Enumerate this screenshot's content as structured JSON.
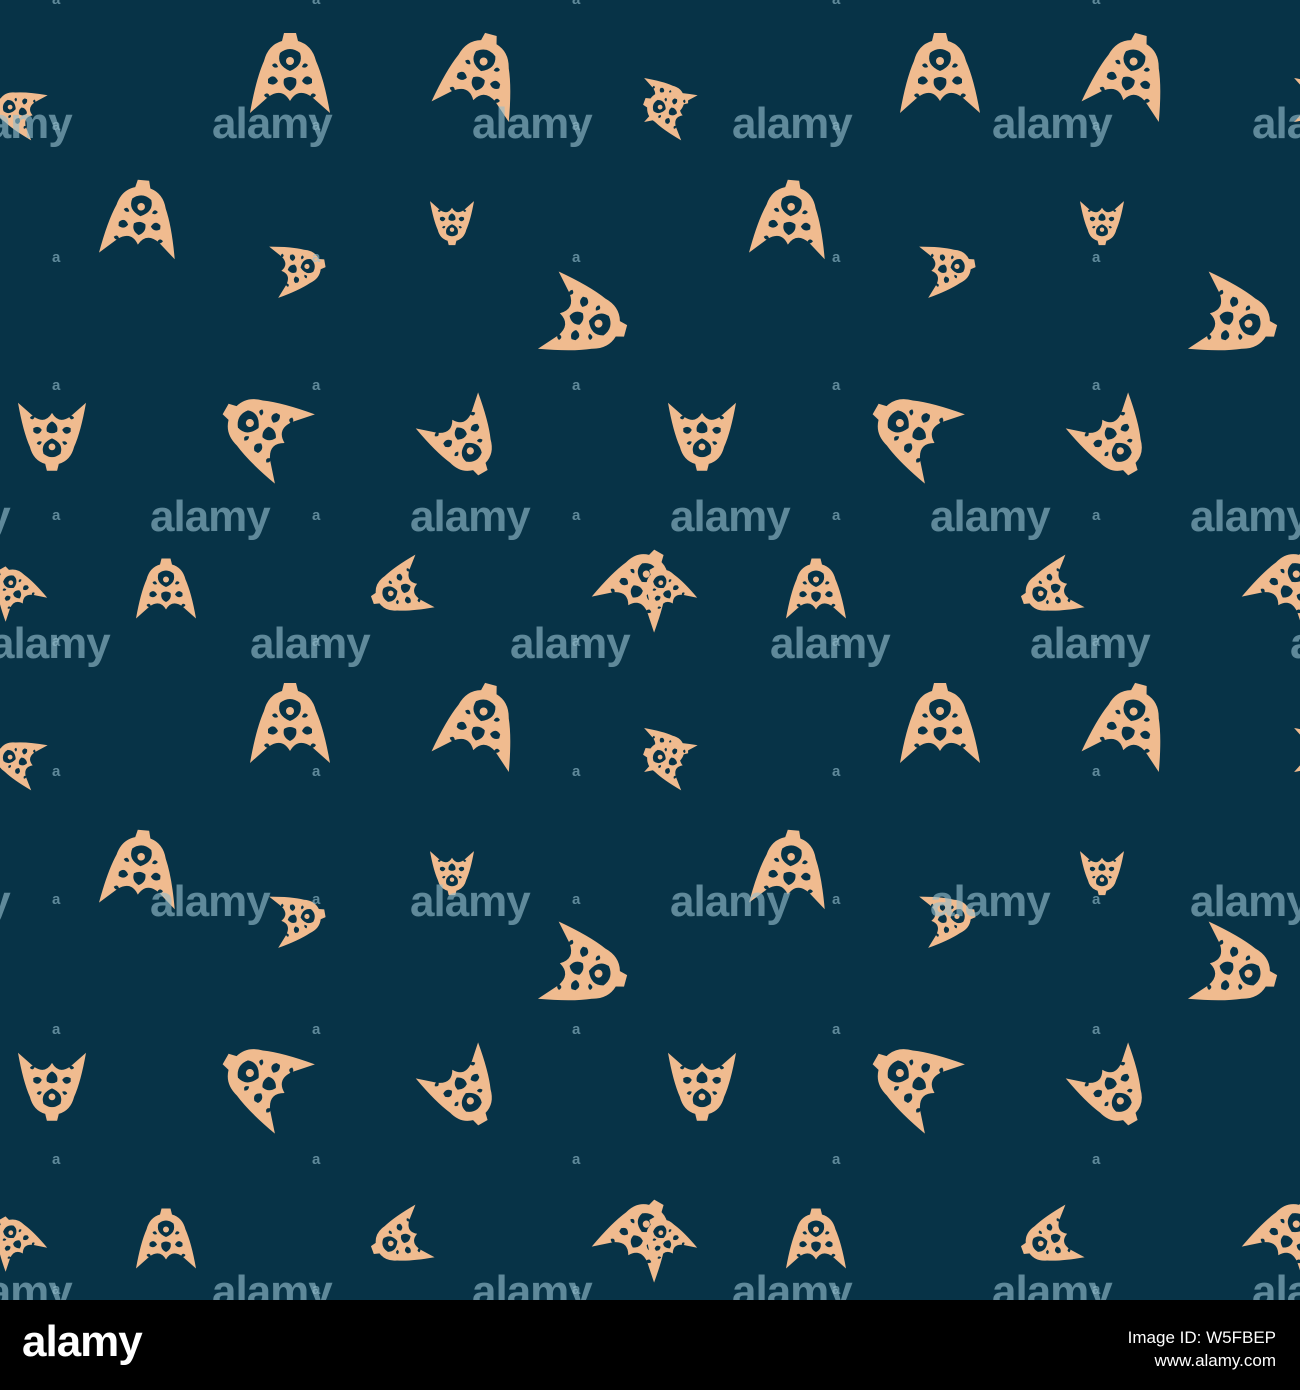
{
  "image": {
    "pattern": {
      "background_color": "#073347",
      "motif_color": "#F0BB8F",
      "motif_name": "ornamental-arrowhead-motif"
    },
    "watermark": {
      "text": "alamy",
      "small_mark": "a",
      "color": "#96BECD"
    }
  },
  "footer": {
    "brand": "alamy",
    "image_id_label": "Image ID: W5FBEP",
    "site": "www.alamy.com"
  }
}
